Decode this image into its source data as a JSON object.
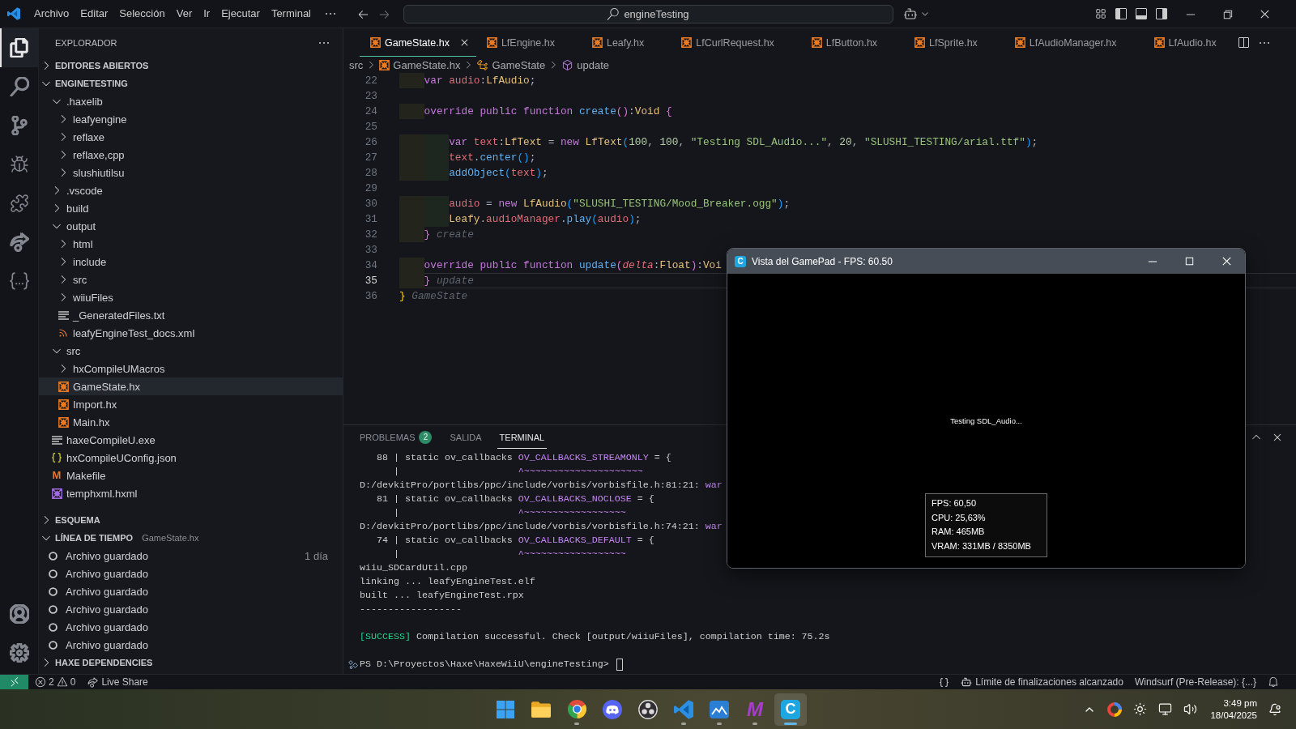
{
  "titlebar": {
    "menus": [
      "Archivo",
      "Editar",
      "Selección",
      "Ver",
      "Ir",
      "Ejecutar",
      "Terminal"
    ],
    "search": {
      "value": "engineTesting"
    }
  },
  "activity_bar": {
    "items": [
      {
        "kind": "explorer",
        "selected": true
      },
      {
        "kind": "search",
        "selected": false
      },
      {
        "kind": "source_control",
        "selected": false
      },
      {
        "kind": "debug",
        "selected": false
      },
      {
        "kind": "extensions",
        "selected": false
      },
      {
        "kind": "live_share",
        "selected": false
      },
      {
        "kind": "json",
        "selected": false
      }
    ],
    "bottom": [
      {
        "kind": "account"
      },
      {
        "kind": "settings"
      }
    ]
  },
  "sidebar": {
    "title": "EXPLORADOR",
    "sections": [
      {
        "title": "EDITORES ABIERTOS",
        "expanded": false
      },
      {
        "title": "ENGINETESTING",
        "expanded": true,
        "children": [
          {
            "name": ".haxelib",
            "kind": "folder",
            "expanded": true,
            "selected": false,
            "children": [
              {
                "name": "leafyengine",
                "kind": "folder",
                "expanded": false,
                "selected": false
              },
              {
                "name": "reflaxe",
                "kind": "folder",
                "expanded": false,
                "selected": false
              },
              {
                "name": "reflaxe,cpp",
                "kind": "folder",
                "expanded": false,
                "selected": false
              },
              {
                "name": "slushiutilsu",
                "kind": "folder",
                "expanded": false,
                "selected": false
              }
            ]
          },
          {
            "name": ".vscode",
            "kind": "folder",
            "expanded": false,
            "selected": false
          },
          {
            "name": "build",
            "kind": "folder",
            "expanded": false,
            "selected": false
          },
          {
            "name": "output",
            "kind": "folder",
            "expanded": true,
            "selected": false,
            "children": [
              {
                "name": "html",
                "kind": "folder",
                "expanded": false,
                "selected": false
              },
              {
                "name": "include",
                "kind": "folder",
                "expanded": false,
                "selected": false
              },
              {
                "name": "src",
                "kind": "folder",
                "expanded": false,
                "selected": false
              },
              {
                "name": "wiiuFiles",
                "kind": "folder",
                "expanded": false,
                "selected": false
              },
              {
                "name": "_GeneratedFiles.txt",
                "kind": "text",
                "selected": false
              },
              {
                "name": "leafyEngineTest_docs.xml",
                "kind": "feed",
                "selected": false
              }
            ]
          },
          {
            "name": "src",
            "kind": "folder",
            "expanded": true,
            "selected": false,
            "children": [
              {
                "name": "hxCompileUMacros",
                "kind": "folder",
                "expanded": false,
                "selected": false
              },
              {
                "name": "GameState.hx",
                "kind": "haxe",
                "selected": true
              },
              {
                "name": "Import.hx",
                "kind": "haxe",
                "selected": false
              },
              {
                "name": "Main.hx",
                "kind": "haxe",
                "selected": false
              }
            ]
          },
          {
            "name": "haxeCompileU.exe",
            "kind": "text",
            "selected": false
          },
          {
            "name": "hxCompileUConfig.json",
            "kind": "json",
            "selected": false
          },
          {
            "name": "Makefile",
            "kind": "makefile",
            "glyph": "M",
            "selected": false
          },
          {
            "name": "temphxml.hxml",
            "kind": "hxml",
            "selected": false
          }
        ]
      },
      {
        "title": "ESQUEMA",
        "expanded": false
      },
      {
        "title": "LÍNEA DE TIEMPO",
        "expanded": true,
        "description": "GameState.hx",
        "entries": [
          {
            "label": "Archivo guardado",
            "time": "1 día"
          },
          {
            "label": "Archivo guardado"
          },
          {
            "label": "Archivo guardado"
          },
          {
            "label": "Archivo guardado"
          },
          {
            "label": "Archivo guardado"
          },
          {
            "label": "Archivo guardado"
          }
        ]
      },
      {
        "title": "HAXE DEPENDENCIES",
        "expanded": false
      }
    ]
  },
  "editor": {
    "tabs": [
      {
        "label": "GameState.hx",
        "selected": true
      },
      {
        "label": "LfEngine.hx",
        "selected": false
      },
      {
        "label": "Leafy.hx",
        "selected": false
      },
      {
        "label": "LfCurlRequest.hx",
        "selected": false
      },
      {
        "label": "LfButton.hx",
        "selected": false
      },
      {
        "label": "LfSprite.hx",
        "selected": false
      },
      {
        "label": "LfAudioManager.hx",
        "selected": false
      },
      {
        "label": "LfAudio.hx",
        "selected": false
      }
    ],
    "breadcrumbs": [
      {
        "label": "src",
        "kind": "folder"
      },
      {
        "label": "GameState.hx",
        "kind": "haxe"
      },
      {
        "label": "GameState",
        "kind": "class"
      },
      {
        "label": "update",
        "kind": "method"
      }
    ],
    "lines": [
      {
        "number": "22",
        "current": false,
        "tokens": [
          {
            "text": "    var",
            "kind": "keyword"
          },
          {
            "text": " audio",
            "kind": "variable"
          },
          {
            "text": ":",
            "kind": "punct"
          },
          {
            "text": "LfAudio",
            "kind": "type"
          },
          {
            "text": ";",
            "kind": "punct"
          }
        ]
      },
      {
        "number": "23",
        "current": false
      },
      {
        "number": "24",
        "current": false,
        "tokens": [
          {
            "text": "    override public function",
            "kind": "keyword"
          },
          {
            "text": " create",
            "kind": "function"
          },
          {
            "text": "()",
            "kind": "bracket2"
          },
          {
            "text": ":",
            "kind": "punct"
          },
          {
            "text": "Void",
            "kind": "type"
          },
          {
            "text": " {",
            "kind": "bracket2"
          }
        ]
      },
      {
        "number": "25",
        "current": false
      },
      {
        "number": "26",
        "current": false,
        "tokens": [
          {
            "text": "        var",
            "kind": "keyword"
          },
          {
            "text": " text",
            "kind": "variable"
          },
          {
            "text": ":",
            "kind": "punct"
          },
          {
            "text": "LfText",
            "kind": "type"
          },
          {
            "text": " = ",
            "kind": "punct"
          },
          {
            "text": "new",
            "kind": "keyword"
          },
          {
            "text": " LfText",
            "kind": "type"
          },
          {
            "text": "(",
            "kind": "bracket3"
          },
          {
            "text": "100",
            "kind": "number"
          },
          {
            "text": ", ",
            "kind": "punct"
          },
          {
            "text": "100",
            "kind": "number"
          },
          {
            "text": ", ",
            "kind": "punct"
          },
          {
            "text": "\"Testing SDL_Audio...\"",
            "kind": "string"
          },
          {
            "text": ", ",
            "kind": "punct"
          },
          {
            "text": "20",
            "kind": "number"
          },
          {
            "text": ", ",
            "kind": "punct"
          },
          {
            "text": "\"SLUSHI_TESTING/arial.ttf\"",
            "kind": "string"
          },
          {
            "text": ")",
            "kind": "bracket3"
          },
          {
            "text": ";",
            "kind": "punct"
          }
        ]
      },
      {
        "number": "27",
        "current": false,
        "tokens": [
          {
            "text": "        text",
            "kind": "variable"
          },
          {
            "text": ".",
            "kind": "punct"
          },
          {
            "text": "center",
            "kind": "function"
          },
          {
            "text": "()",
            "kind": "bracket3"
          },
          {
            "text": ";",
            "kind": "punct"
          }
        ]
      },
      {
        "number": "28",
        "current": false,
        "tokens": [
          {
            "text": "        addObject",
            "kind": "function"
          },
          {
            "text": "(",
            "kind": "bracket3"
          },
          {
            "text": "text",
            "kind": "variable"
          },
          {
            "text": ")",
            "kind": "bracket3"
          },
          {
            "text": ";",
            "kind": "punct"
          }
        ]
      },
      {
        "number": "29",
        "current": false
      },
      {
        "number": "30",
        "current": false,
        "tokens": [
          {
            "text": "        audio",
            "kind": "variable"
          },
          {
            "text": " = ",
            "kind": "punct"
          },
          {
            "text": "new",
            "kind": "keyword"
          },
          {
            "text": " LfAudio",
            "kind": "type"
          },
          {
            "text": "(",
            "kind": "bracket3"
          },
          {
            "text": "\"SLUSHI_TESTING/Mood_Breaker.ogg\"",
            "kind": "string"
          },
          {
            "text": ")",
            "kind": "bracket3"
          },
          {
            "text": ";",
            "kind": "punct"
          }
        ]
      },
      {
        "number": "31",
        "current": false,
        "tokens": [
          {
            "text": "        Leafy",
            "kind": "type"
          },
          {
            "text": ".",
            "kind": "punct"
          },
          {
            "text": "audioManager",
            "kind": "variable"
          },
          {
            "text": ".",
            "kind": "punct"
          },
          {
            "text": "play",
            "kind": "function"
          },
          {
            "text": "(",
            "kind": "bracket3"
          },
          {
            "text": "audio",
            "kind": "variable"
          },
          {
            "text": ")",
            "kind": "bracket3"
          },
          {
            "text": ";",
            "kind": "punct"
          }
        ]
      },
      {
        "number": "32",
        "current": false,
        "tokens": [
          {
            "text": "    }",
            "kind": "bracket2"
          },
          {
            "text": " create",
            "kind": "hint"
          }
        ]
      },
      {
        "number": "33",
        "current": false
      },
      {
        "number": "34",
        "current": false,
        "tokens": [
          {
            "text": "    override public function",
            "kind": "keyword"
          },
          {
            "text": " update",
            "kind": "function"
          },
          {
            "text": "(",
            "kind": "bracket2"
          },
          {
            "text": "delta",
            "kind": "param"
          },
          {
            "text": ":",
            "kind": "punct"
          },
          {
            "text": "Float",
            "kind": "type"
          },
          {
            "text": ")",
            "kind": "bracket2"
          },
          {
            "text": ":",
            "kind": "punct"
          },
          {
            "text": "Voi",
            "kind": "type"
          }
        ]
      },
      {
        "number": "35",
        "current": true,
        "tokens": [
          {
            "text": "    }",
            "kind": "bracket2"
          },
          {
            "text": " update",
            "kind": "hint"
          }
        ]
      },
      {
        "number": "36",
        "current": false,
        "tokens": [
          {
            "text": "}",
            "kind": "bracket1"
          },
          {
            "text": " GameState",
            "kind": "hint"
          }
        ]
      }
    ]
  },
  "panel": {
    "tabs": [
      {
        "label": "PROBLEMAS",
        "badge": "2",
        "selected": false
      },
      {
        "label": "SALIDA",
        "selected": false
      },
      {
        "label": "TERMINAL",
        "selected": true
      }
    ],
    "terminal": {
      "lines": [
        {
          "kind": "output",
          "tokens": [
            {
              "text": "   88 | static ov_callbacks ",
              "kind": "plain"
            },
            {
              "text": "OV_CALLBACKS_STREAMONLY",
              "kind": "warning"
            },
            {
              "text": " = {",
              "kind": "plain"
            }
          ]
        },
        {
          "kind": "output",
          "tokens": [
            {
              "text": "      |",
              "kind": "plain"
            },
            {
              "text": "                     ^~~~~~~~~~~~~~~~~~~~~~",
              "kind": "warning"
            }
          ]
        },
        {
          "kind": "output",
          "tokens": [
            {
              "text": "D:/devkitPro/portlibs/ppc/include/vorbis/vorbisfile.h:81:21: ",
              "kind": "plain"
            },
            {
              "text": "war",
              "kind": "warning"
            }
          ]
        },
        {
          "kind": "output",
          "tokens": [
            {
              "text": "   81 | static ov_callbacks ",
              "kind": "plain"
            },
            {
              "text": "OV_CALLBACKS_NOCLOSE",
              "kind": "warning"
            },
            {
              "text": " = {",
              "kind": "plain"
            }
          ]
        },
        {
          "kind": "output",
          "tokens": [
            {
              "text": "      |",
              "kind": "plain"
            },
            {
              "text": "                     ^~~~~~~~~~~~~~~~~~~",
              "kind": "warning"
            }
          ]
        },
        {
          "kind": "output",
          "tokens": [
            {
              "text": "D:/devkitPro/portlibs/ppc/include/vorbis/vorbisfile.h:74:21: ",
              "kind": "plain"
            },
            {
              "text": "war",
              "kind": "warning"
            }
          ]
        },
        {
          "kind": "output",
          "tokens": [
            {
              "text": "   74 | static ov_callbacks ",
              "kind": "plain"
            },
            {
              "text": "OV_CALLBACKS_DEFAULT",
              "kind": "warning"
            },
            {
              "text": " = {",
              "kind": "plain"
            }
          ]
        },
        {
          "kind": "output",
          "tokens": [
            {
              "text": "      |",
              "kind": "plain"
            },
            {
              "text": "                     ^~~~~~~~~~~~~~~~~~~",
              "kind": "warning"
            }
          ]
        },
        {
          "kind": "output",
          "tokens": [
            {
              "text": "wiiu_SDCardUtil.cpp",
              "kind": "plain"
            }
          ]
        },
        {
          "kind": "output",
          "tokens": [
            {
              "text": "linking ... leafyEngineTest.elf",
              "kind": "plain"
            }
          ]
        },
        {
          "kind": "output",
          "tokens": [
            {
              "text": "built ... leafyEngineTest.rpx",
              "kind": "plain"
            }
          ]
        },
        {
          "kind": "output",
          "tokens": [
            {
              "text": "------------------",
              "kind": "plain"
            }
          ]
        },
        {
          "kind": "blank"
        },
        {
          "kind": "output",
          "tokens": [
            {
              "text": "[SUCCESS]",
              "kind": "success"
            },
            {
              "text": " Compilation successful. Check [output/wiiuFiles], compilation time: 75.2s",
              "kind": "plain"
            }
          ]
        },
        {
          "kind": "blank"
        }
      ],
      "prompt": "PS D:\\Proyectos\\Haxe\\HaxeWiiU\\engineTesting>"
    }
  },
  "game_window": {
    "title": "Vista del GamePad - FPS: 60.50",
    "icon_glyph": "C",
    "canvas_text": "Testing SDL_Audio...",
    "stats": [
      "FPS: 60,50",
      "CPU: 25,63%",
      "RAM: 465MB",
      "VRAM: 331MB / 8350MB"
    ]
  },
  "status_bar": {
    "errors": "2",
    "warnings": "0",
    "live_share": "Live Share",
    "copilot": "Límite de finalizaciones alcanzado",
    "extension": "Windsurf (Pre-Release): {...}"
  },
  "taskbar": {
    "apps": [
      {
        "kind": "start",
        "running": false,
        "selected": false
      },
      {
        "kind": "files",
        "running": false,
        "selected": false
      },
      {
        "kind": "browser",
        "running": true,
        "selected": false
      },
      {
        "kind": "chat",
        "running": false,
        "selected": false
      },
      {
        "kind": "recorder",
        "running": false,
        "selected": false
      },
      {
        "kind": "editor",
        "running": true,
        "selected": false
      },
      {
        "kind": "charts",
        "running": true,
        "selected": false
      },
      {
        "kind": "letter",
        "glyph": "M",
        "color": "#a93bd1",
        "running": true,
        "selected": false
      },
      {
        "kind": "letter_tile",
        "glyph": "C",
        "color": "#1ea6e0",
        "running": true,
        "selected": true
      }
    ],
    "clock": {
      "time": "3:49 pm",
      "date": "18/04/2025"
    }
  }
}
